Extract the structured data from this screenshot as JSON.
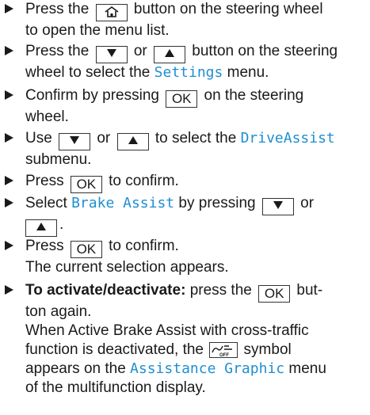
{
  "icons": {
    "home": "home-icon",
    "down": "down-arrow-icon",
    "up": "up-arrow-icon",
    "off_symbol": "brake-assist-off-icon"
  },
  "colors": {
    "display_text": "#1f8fd0"
  },
  "steps": {
    "s1": {
      "a": "Press the",
      "b": "button on the steering wheel",
      "c": "to open the menu list."
    },
    "s2": {
      "a": "Press the",
      "or": "or",
      "b": "button on the steering",
      "c": "wheel to select the",
      "menu": "Settings",
      "d": "menu."
    },
    "s3": {
      "a": "Confirm by pressing",
      "ok": "OK",
      "b": "on the steering",
      "c": "wheel."
    },
    "s4": {
      "a": "Use",
      "or": "or",
      "b": "to select the",
      "menu": "DriveAssist",
      "c": "submenu."
    },
    "s5": {
      "a": "Press",
      "ok": "OK",
      "b": "to confirm."
    },
    "s6": {
      "a": "Select",
      "menu": "Brake Assist",
      "b": "by pressing",
      "or": "or",
      "c": "."
    },
    "s7": {
      "a": "Press",
      "ok": "OK",
      "b": "to confirm.",
      "c": "The current selection appears."
    },
    "s8": {
      "bold": "To activate/deactivate:",
      "a": "press the",
      "ok": "OK",
      "b": "but-",
      "c": "ton again.",
      "d": "When Active Brake Assist with cross-traffic",
      "e": "function is deactivated, the",
      "f": "symbol",
      "g": "appears on the",
      "menu": "Assistance Graphic",
      "h": "menu",
      "i": "of the multifunction display."
    }
  }
}
